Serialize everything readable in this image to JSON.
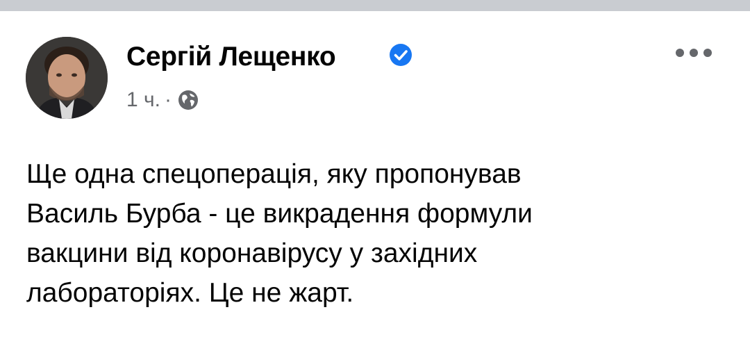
{
  "post": {
    "author_name": "Сергій Лещенко",
    "timestamp": "1 ч.",
    "separator": "·",
    "audience_icon": "globe-icon",
    "verified_icon": "verified-badge-icon",
    "more_icon": "more-options-icon",
    "text": "Ще одна спецоперація, яку пропонував\nВасиль Бурба - це викрадення формули\nвакцини від коронавірусу у західних\nлабораторіях. Це не жарт."
  },
  "colors": {
    "top_strip": "#c9ccd1",
    "verified_blue": "#1877f2",
    "secondary_text": "#65676b",
    "primary_text": "#050505"
  }
}
